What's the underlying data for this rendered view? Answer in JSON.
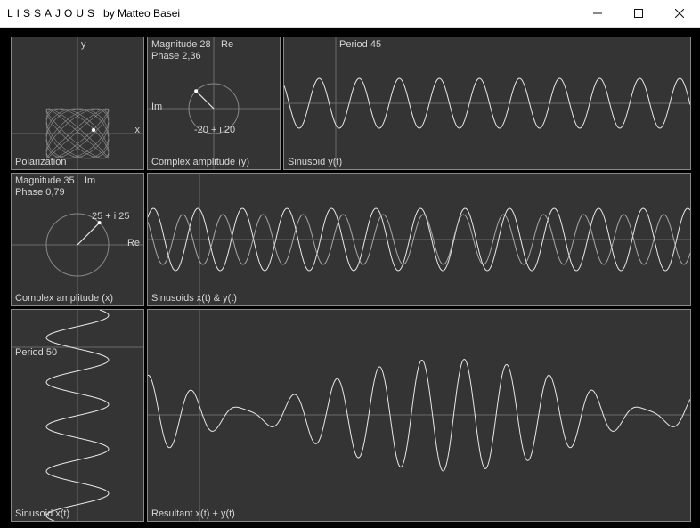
{
  "window": {
    "app_title": "LISSAJOUS",
    "author": "by Matteo Basei"
  },
  "panels": {
    "polarization": {
      "caption": "Polarization",
      "x_label": "x",
      "y_label": "y"
    },
    "complex_y": {
      "caption": "Complex amplitude (y)",
      "magnitude": "Magnitude 28",
      "phase": "Phase 2,36",
      "re": "Re",
      "im": "Im",
      "value": "-20 + i 20"
    },
    "sinusoid_y": {
      "caption": "Sinusoid y(t)",
      "period": "Period 45"
    },
    "complex_x": {
      "caption": "Complex amplitude (x)",
      "magnitude": "Magnitude 35",
      "phase": "Phase 0,79",
      "re": "Re",
      "im": "Im",
      "value": "25 + i 25"
    },
    "sinusoids_xy": {
      "caption": "Sinusoids x(t) & y(t)"
    },
    "sinusoid_x": {
      "caption": "Sinusoid x(t)",
      "period": "Period 50"
    },
    "resultant": {
      "caption": "Resultant x(t) + y(t)"
    }
  },
  "chart_data": {
    "x_wave": {
      "amplitude": 35,
      "phase_rad": 0.79,
      "period": 50,
      "complex": "25 + i 25"
    },
    "y_wave": {
      "amplitude": 28,
      "phase_rad": 2.36,
      "period": 45,
      "complex": "-20 + i 20"
    }
  }
}
